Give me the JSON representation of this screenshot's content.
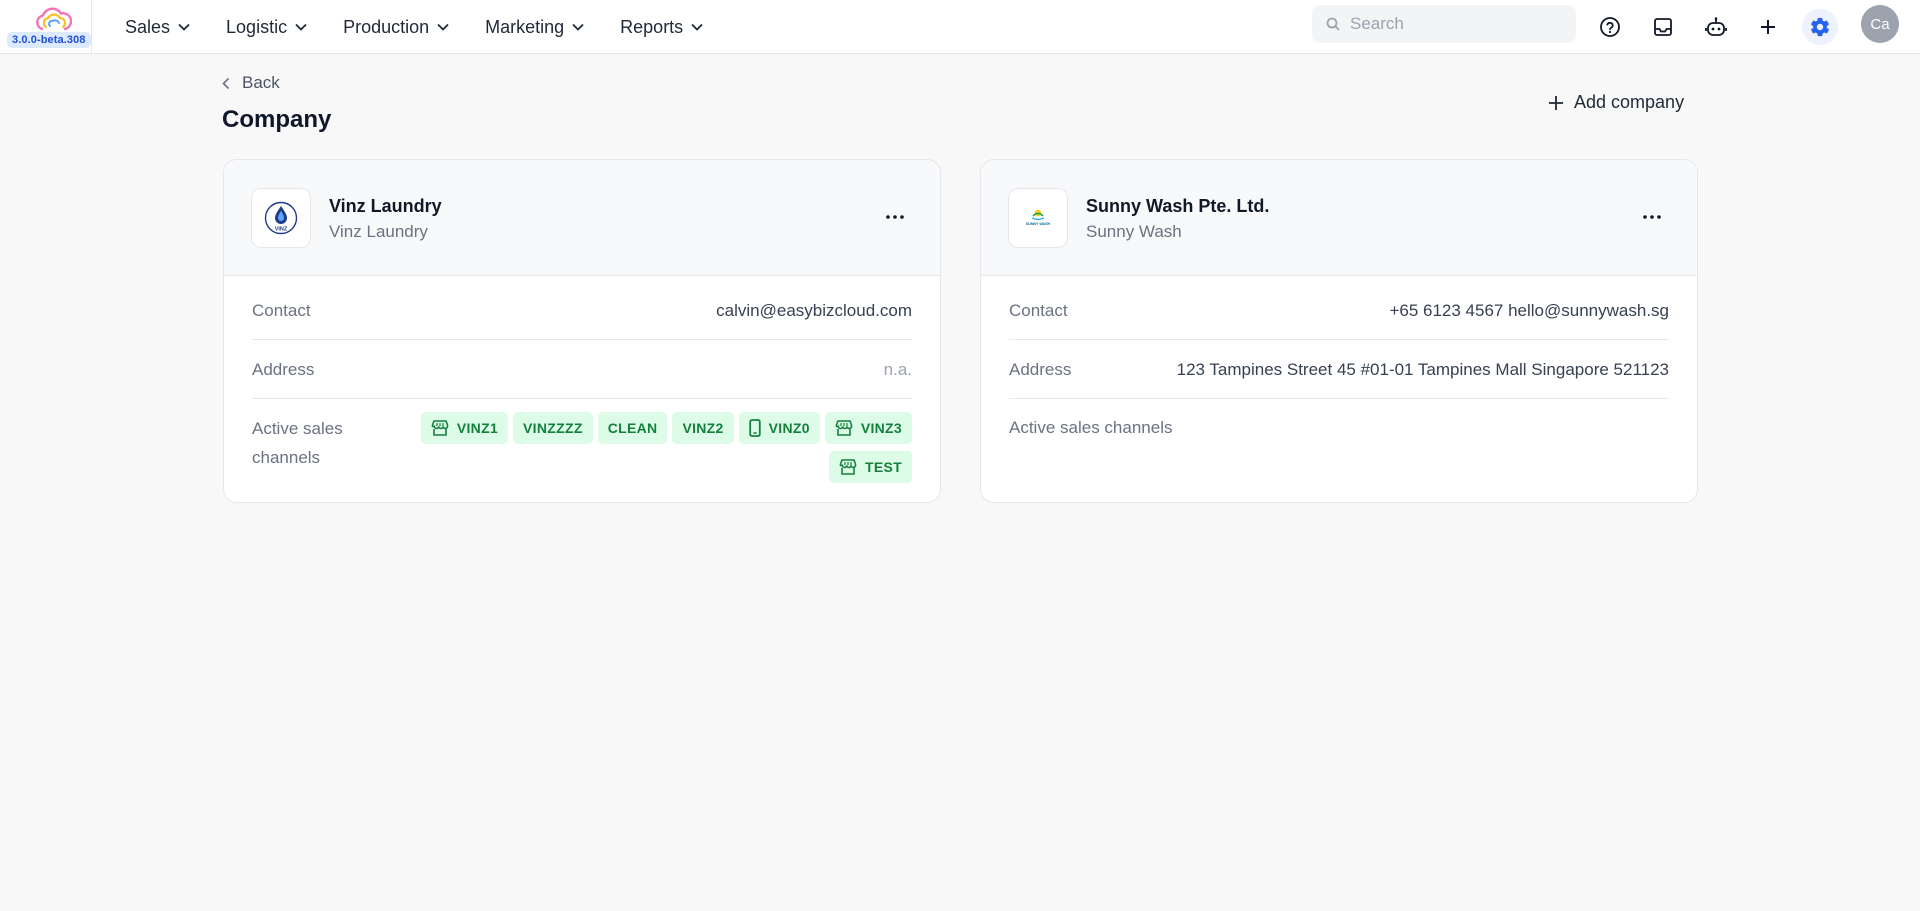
{
  "app": {
    "version": "3.0.0-beta.308"
  },
  "nav": {
    "menu": [
      {
        "label": "Sales"
      },
      {
        "label": "Logistic"
      },
      {
        "label": "Production"
      },
      {
        "label": "Marketing"
      },
      {
        "label": "Reports"
      }
    ],
    "search_placeholder": "Search",
    "icons": [
      "help-circle-icon",
      "inbox-icon",
      "robot-icon",
      "plus-icon",
      "gear-icon"
    ],
    "avatar_initials": "Ca"
  },
  "page": {
    "back_label": "Back",
    "title": "Company",
    "add_label": "Add company"
  },
  "labels": {
    "contact": "Contact",
    "address": "Address",
    "active_sales_channels": "Active sales channels"
  },
  "companies": [
    {
      "name": "Vinz Laundry",
      "short_name": "Vinz Laundry",
      "logo_text": "VINZ",
      "contact": "calvin@easybizcloud.com",
      "address": "n.a.",
      "channels": [
        {
          "label": "VINZ1",
          "icon": "storefront-icon"
        },
        {
          "label": "VINZZZZ",
          "icon": ""
        },
        {
          "label": "CLEAN",
          "icon": ""
        },
        {
          "label": "VINZ2",
          "icon": ""
        },
        {
          "label": "VINZ0",
          "icon": "mobile-phone-icon"
        },
        {
          "label": "VINZ3",
          "icon": "storefront-icon"
        },
        {
          "label": "TEST",
          "icon": "storefront-icon"
        }
      ]
    },
    {
      "name": "Sunny Wash Pte. Ltd.",
      "short_name": "Sunny Wash",
      "logo_text": "SUNNY WASH",
      "contact": "+65 6123 4567 hello@sunnywash.sg",
      "address": "123 Tampines Street 45 #01-01 Tampines Mall Singapore 521123",
      "channels": []
    }
  ],
  "colors": {
    "chip_bg": "#dcfce7",
    "chip_text": "#15803d",
    "badge_bg": "#dbeafe",
    "badge_text": "#1d4ed8",
    "gear_active": "#2563eb"
  }
}
